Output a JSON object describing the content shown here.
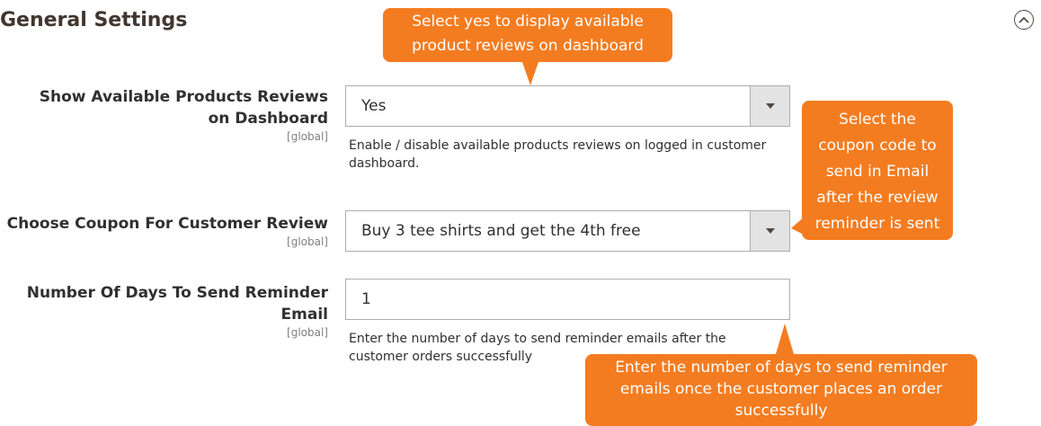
{
  "section": {
    "title": "General Settings"
  },
  "fields": {
    "show_reviews": {
      "label": "Show Available Products Reviews on Dashboard",
      "scope": "[global]",
      "value": "Yes",
      "note": "Enable / disable available products reviews on logged in customer dashboard."
    },
    "coupon": {
      "label": "Choose Coupon For Customer Review",
      "scope": "[global]",
      "value": "Buy 3 tee shirts and get the 4th free"
    },
    "reminder_days": {
      "label": "Number Of Days To Send Reminder Email",
      "scope": "[global]",
      "value": "1",
      "note": "Enter the number of days to send reminder emails after the customer orders successfully"
    }
  },
  "callouts": {
    "reviews": "Select yes to display available product reviews on dashboard",
    "coupon": "Select the coupon code to send in Email after the review reminder is sent",
    "days": "Enter the number of days to send reminder emails once the customer places an order successfully"
  },
  "icons": {
    "collapse": "chevron-up-circle-icon",
    "dropdown": "triangle-down-icon"
  },
  "colors": {
    "callout": "#f47c20",
    "title": "#41362f",
    "border": "#adadad",
    "arrow_bg": "#e3e3e3"
  }
}
